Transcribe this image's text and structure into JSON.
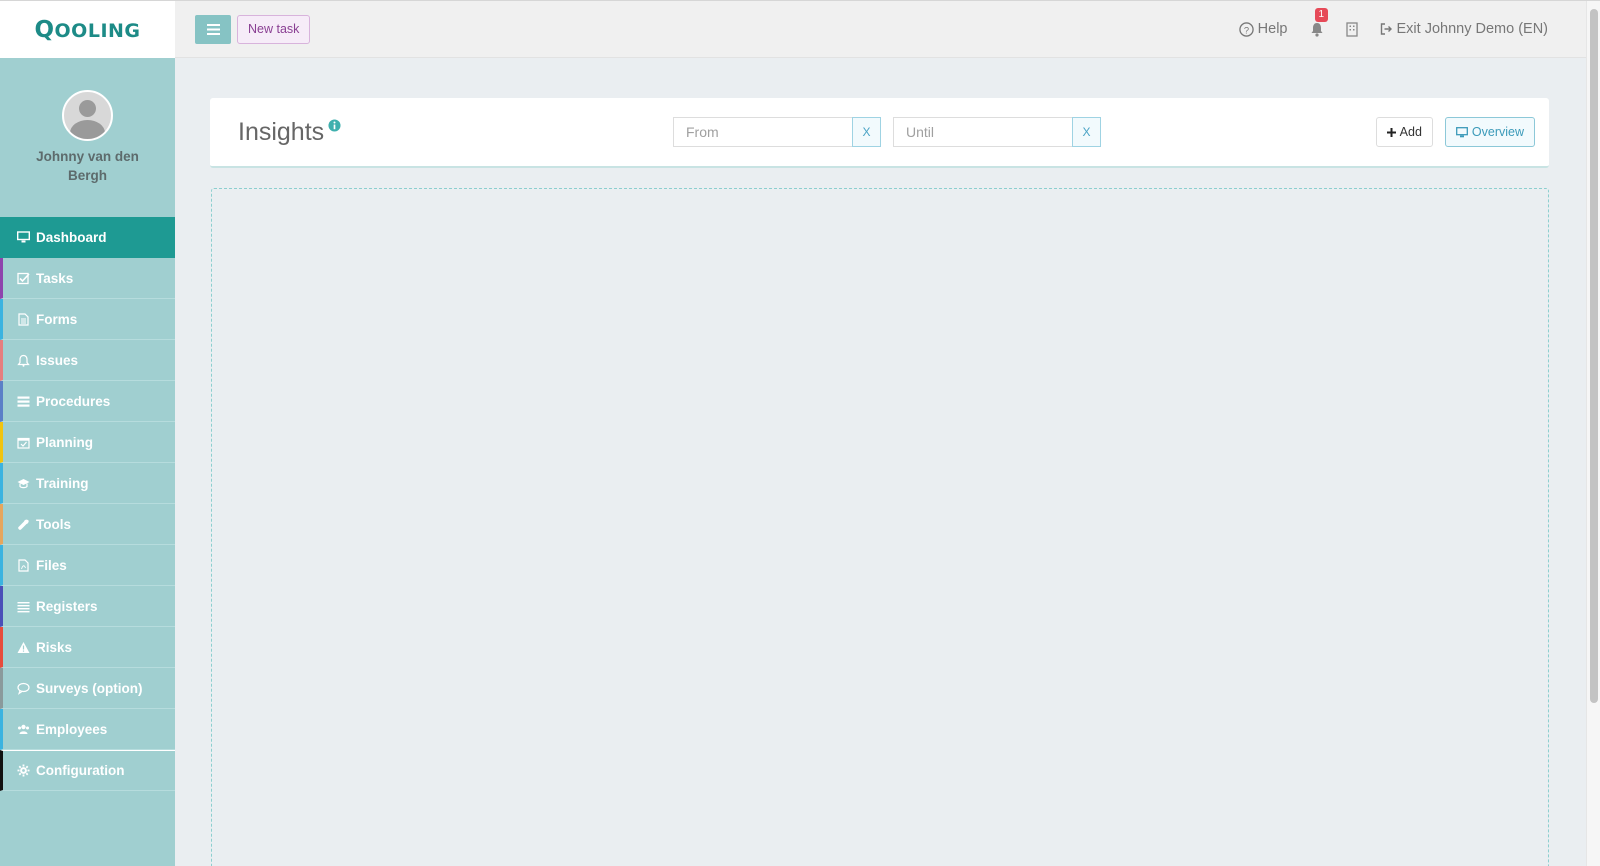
{
  "app": {
    "logo": "Qooling"
  },
  "profile": {
    "name": "Johnny van den Bergh"
  },
  "sidebar": {
    "items": [
      {
        "label": "Dashboard",
        "icon": "monitor-icon",
        "accent": "#1e9a93"
      },
      {
        "label": "Tasks",
        "icon": "check-square-icon",
        "accent": "#8e44ad"
      },
      {
        "label": "Forms",
        "icon": "document-icon",
        "accent": "#3bb3e0"
      },
      {
        "label": "Issues",
        "icon": "bell-icon",
        "accent": "#e67e7e"
      },
      {
        "label": "Procedures",
        "icon": "list-icon",
        "accent": "#5b7fc7"
      },
      {
        "label": "Planning",
        "icon": "calendar-icon",
        "accent": "#f1c40f"
      },
      {
        "label": "Training",
        "icon": "graduation-cap-icon",
        "accent": "#3bb3e0"
      },
      {
        "label": "Tools",
        "icon": "wrench-icon",
        "accent": "#e6a65d"
      },
      {
        "label": "Files",
        "icon": "pdf-icon",
        "accent": "#3bb3e0"
      },
      {
        "label": "Registers",
        "icon": "lines-icon",
        "accent": "#4a4fb8"
      },
      {
        "label": "Risks",
        "icon": "warning-icon",
        "accent": "#e74c3c"
      },
      {
        "label": "Surveys (option)",
        "icon": "chat-icon",
        "accent": "#8a9a9b"
      },
      {
        "label": "Employees",
        "icon": "users-icon",
        "accent": "#3bb3e0"
      },
      {
        "label": "Configuration",
        "icon": "gear-icon",
        "accent": "#111111"
      }
    ]
  },
  "topbar": {
    "new_task_label": "New task",
    "help_label": "Help",
    "notification_count": "1",
    "exit_label": "Exit Johnny Demo (EN)"
  },
  "insights": {
    "title": "Insights",
    "from_placeholder": "From",
    "until_placeholder": "Until",
    "clear_label": "X",
    "add_label": "Add",
    "overview_label": "Overview"
  }
}
